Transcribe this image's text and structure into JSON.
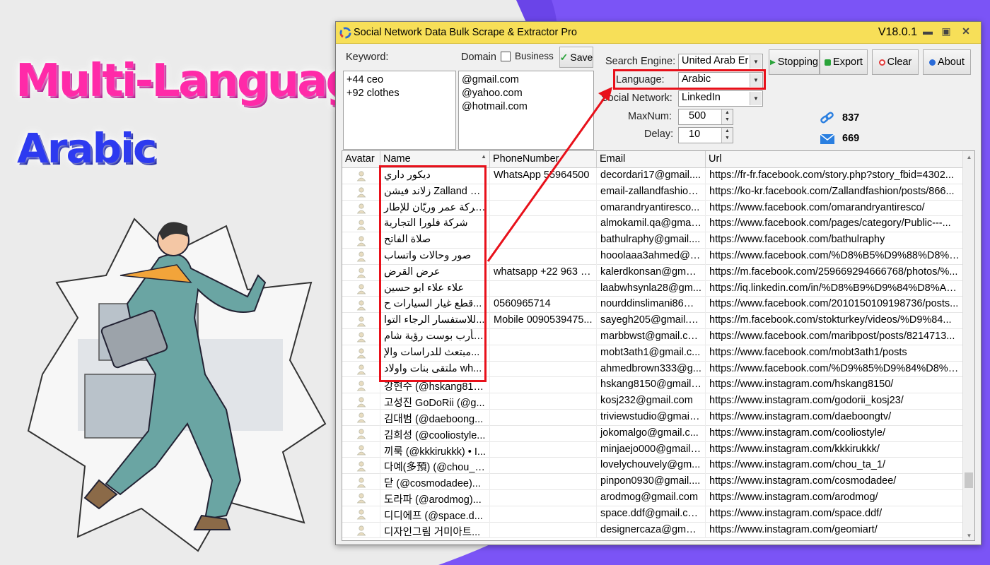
{
  "promo": {
    "title": "Multi-Language",
    "subtitle": "Arabic"
  },
  "window": {
    "title": "Social Network Data Bulk Scrape & Extractor Pro",
    "version": "V18.0.1"
  },
  "form": {
    "keyword_label": "Keyword:",
    "keywords": [
      "+44 ceo",
      "+92 clothes"
    ],
    "domain_label": "Domain",
    "business_label": "Business",
    "business_checked": false,
    "domains": [
      "@gmail.com",
      "@yahoo.com",
      "@hotmail.com"
    ],
    "save_label": "Save",
    "search_engine_label": "Search Engine:",
    "search_engine_value": "United Arab Er",
    "language_label": "Language:",
    "language_value": "Arabic",
    "social_network_label": "Social Network:",
    "social_network_value": "LinkedIn",
    "maxnum_label": "MaxNum:",
    "maxnum_value": "500",
    "delay_label": "Delay:",
    "delay_value": "10"
  },
  "toolbar": {
    "stopping_label": "Stopping",
    "export_label": "Export",
    "clear_label": "Clear",
    "about_label": "About"
  },
  "stats": {
    "links": "837",
    "emails": "669"
  },
  "grid": {
    "columns": [
      "Avatar",
      "Name",
      "PhoneNumber",
      "Email",
      "Url"
    ],
    "rows": [
      {
        "name": "ديكور داري",
        "phone": "WhatsApp 55964500",
        "email": "decordari17@gmail....",
        "url": "https://fr-fr.facebook.com/story.php?story_fbid=4302..."
      },
      {
        "name": "زلاند فيشن Zalland Fa...",
        "phone": "",
        "email": "email-zallandfashion...",
        "url": "https://ko-kr.facebook.com/Zallandfashion/posts/866..."
      },
      {
        "name": "شركة عمر وريّان للإطار...",
        "phone": "",
        "email": "omarandryantiresco...",
        "url": "https://www.facebook.com/omarandryantiresco/"
      },
      {
        "name": "شركة فلورا التجارية",
        "phone": "",
        "email": "almokamil.qa@gmai...",
        "url": "https://www.facebook.com/pages/category/Public---..."
      },
      {
        "name": "صلاة الفاتح",
        "phone": "",
        "email": "bathulraphy@gmail....",
        "url": "https://www.facebook.com/bathulraphy"
      },
      {
        "name": "صور وحالات واتساب",
        "phone": "",
        "email": "hooolaaa3ahmed@g...",
        "url": "https://www.facebook.com/%D8%B5%D9%88%D8%B..."
      },
      {
        "name": "عرض القرض",
        "phone": "whatsapp +22 963 6...",
        "email": "kalerdkonsan@gmai...",
        "url": "https://m.facebook.com/259669294666768/photos/%..."
      },
      {
        "name": "علاء علاء ابو حسين",
        "phone": "",
        "email": "laabwhsynla28@gm...",
        "url": "https://iq.linkedin.com/in/%D8%B9%D9%84%D8%A7..."
      },
      {
        "name": "قطع غيار السيارات ح...",
        "phone": " 0560965714",
        "email": "nourddinslimani86@...",
        "url": "https://www.facebook.com/2010150109198736/posts..."
      },
      {
        "name": "للاستفسار الرجاء التوا...",
        "phone": "Mobile 0090539475...",
        "email": "sayegh205@gmail.c...",
        "url": "https://m.facebook.com/stokturkey/videos/%D9%84..."
      },
      {
        "name": "مأرب بوست رؤية شام...",
        "phone": "",
        "email": "marbbwst@gmail.com",
        "url": "https://www.facebook.com/maribpost/posts/8214713..."
      },
      {
        "name": "مبتعث للدراسات والإ...",
        "phone": "",
        "email": "mobt3ath1@gmail.c...",
        "url": "https://www.facebook.com/mobt3ath1/posts"
      },
      {
        "name": "ملتقى بنات واولاد wh...",
        "phone": "",
        "email": "ahmedbrown333@g...",
        "url": "https://www.facebook.com/%D9%85%D9%84%D8%A..."
      },
      {
        "name": "강현수 (@hskang815...",
        "phone": "",
        "email": "hskang8150@gmail....",
        "url": "https://www.instagram.com/hskang8150/"
      },
      {
        "name": "고성진 GoDoRii (@g...",
        "phone": "",
        "email": "kosj232@gmail.com",
        "url": "https://www.instagram.com/godorii_kosj23/"
      },
      {
        "name": "김대범 (@daeboong...",
        "phone": "",
        "email": "triviewstudio@gmail....",
        "url": "https://www.instagram.com/daeboongtv/"
      },
      {
        "name": "김희성 (@cooliostyle...",
        "phone": "",
        "email": "jokomalgo@gmail.c...",
        "url": "https://www.instagram.com/cooliostyle/"
      },
      {
        "name": "끼룩 (@kkkirukkk) • I...",
        "phone": "",
        "email": "minjaejo000@gmail....",
        "url": "https://www.instagram.com/kkkirukkk/"
      },
      {
        "name": "다예(多預) (@chou_t...",
        "phone": "",
        "email": "lovelychouvely@gm...",
        "url": "https://www.instagram.com/chou_ta_1/"
      },
      {
        "name": "닫   (@cosmodadee)...",
        "phone": "",
        "email": "pinpon0930@gmail....",
        "url": "https://www.instagram.com/cosmodadee/"
      },
      {
        "name": "도라파 (@arodmog)...",
        "phone": "",
        "email": "arodmog@gmail.com",
        "url": "https://www.instagram.com/arodmog/"
      },
      {
        "name": "디디에프 (@space.d...",
        "phone": "",
        "email": "space.ddf@gmail.com",
        "url": "https://www.instagram.com/space.ddf/"
      },
      {
        "name": "디자인그림 거미아트...",
        "phone": "",
        "email": "designercaza@gmail....",
        "url": "https://www.instagram.com/geomiart/"
      }
    ]
  },
  "colors": {
    "titlebar": "#f7df58",
    "highlight": "#e8101a",
    "purple": "#7b54f6",
    "promo_pink": "#ff2aa8",
    "promo_blue": "#2d3af0"
  }
}
